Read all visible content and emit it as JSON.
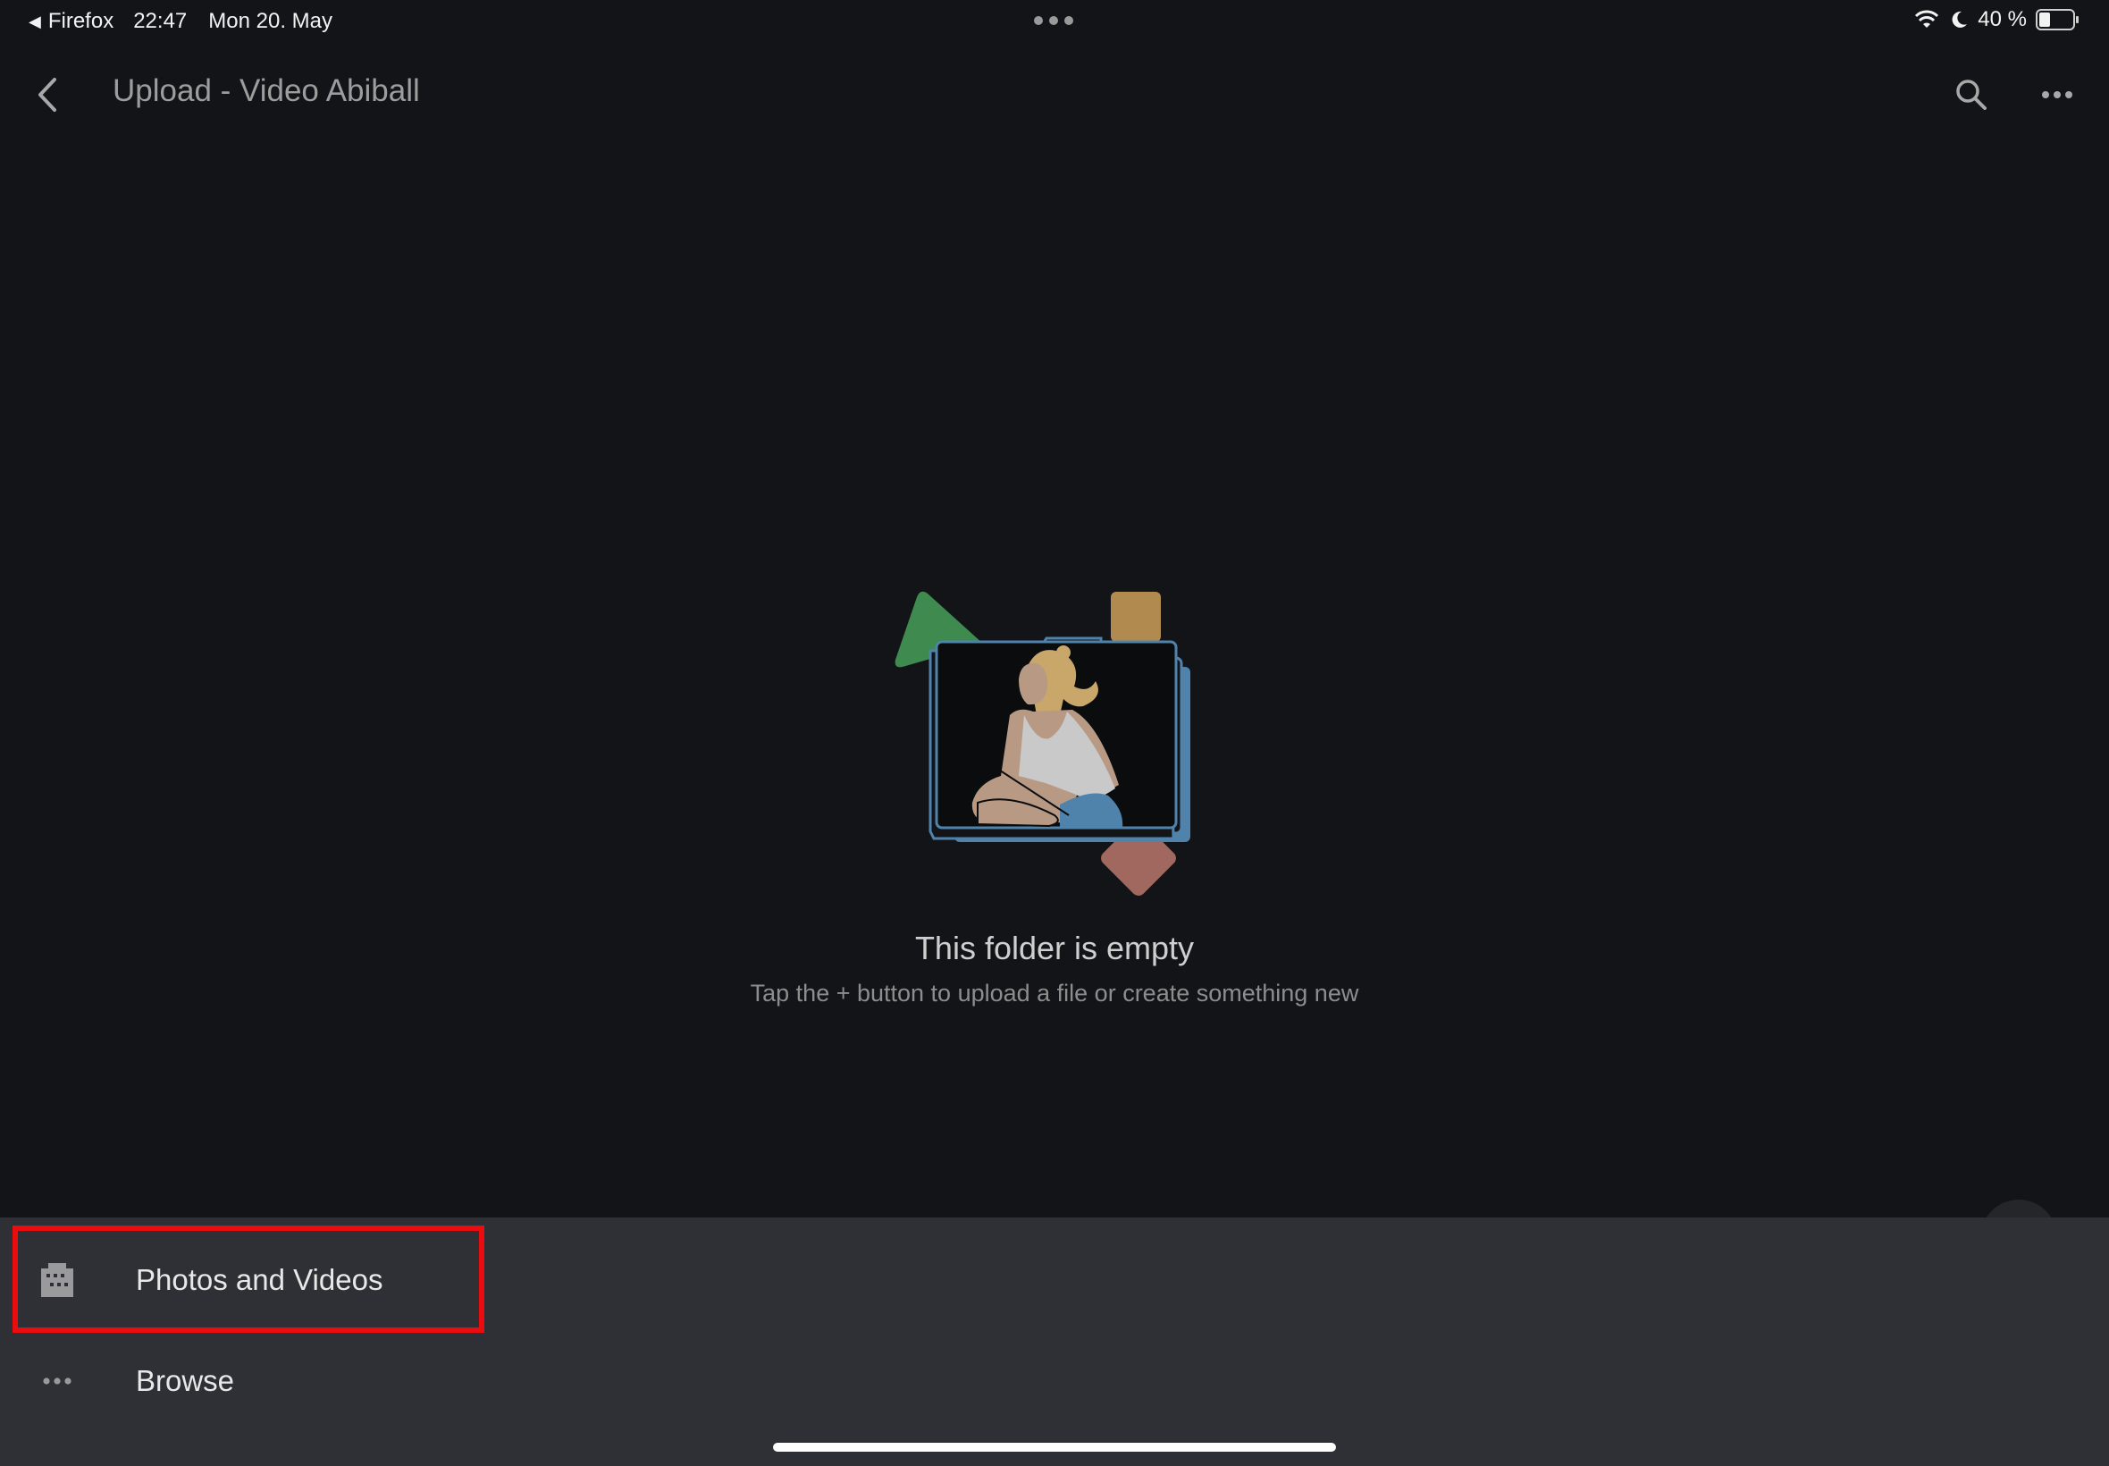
{
  "status_bar": {
    "back_app": "Firefox",
    "time": "22:47",
    "date": "Mon 20. May",
    "battery": "40 %",
    "battery_level": 0.4,
    "icons": [
      "wifi-icon",
      "moon-icon",
      "battery-icon"
    ]
  },
  "header": {
    "title": "Upload - Video Abiball",
    "icons": [
      "back-arrow-icon",
      "search-icon",
      "more-horizontal-icon"
    ]
  },
  "empty_state": {
    "title": "This folder is empty",
    "subtitle": "Tap the + button to upload a file or create something new"
  },
  "bottom_sheet": {
    "items": [
      {
        "label": "Photos and Videos",
        "icon": "photo-library-icon",
        "highlighted": true
      },
      {
        "label": "Browse",
        "icon": "more-horizontal-icon",
        "highlighted": false
      }
    ]
  },
  "colors": {
    "background": "#131417",
    "sheet": "#2f3035",
    "highlight": "#ec0b0f",
    "illustration_green": "#3f8a4f",
    "illustration_gold": "#b08a4e",
    "illustration_blue": "#4f83ac",
    "illustration_rose": "#a0685f"
  }
}
